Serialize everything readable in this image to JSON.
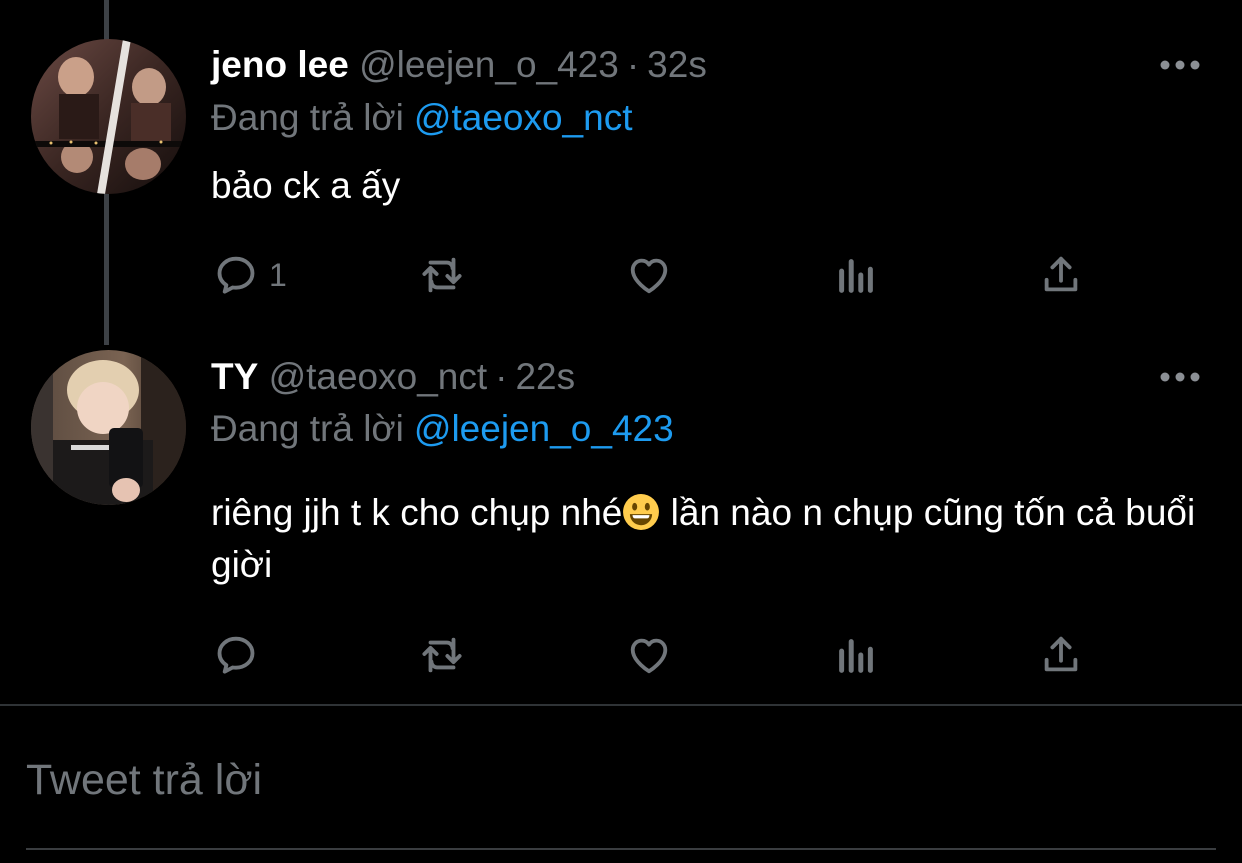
{
  "tweets": [
    {
      "display_name": "jeno lee",
      "handle": "@leejen_o_423",
      "separator": "·",
      "time": "32s",
      "reply_prefix": "Đang trả lời",
      "reply_to": "@taeoxo_nct",
      "text": "bảo ck a ấy",
      "reply_count": "1",
      "avatar_icon": "user-avatar-photo-collage",
      "more_icon": "more-options-icon"
    },
    {
      "display_name": "TY",
      "handle": "@taeoxo_nct",
      "separator": "·",
      "time": "22s",
      "reply_prefix": "Đang trả lời",
      "reply_to": "@leejen_o_423",
      "text_before_emoji": "riêng jjh t k cho chụp nhé",
      "emoji": "grinning-face-emoji",
      "text_after_emoji": " lần nào n chụp cũng tốn cả buổi giời",
      "reply_count": "",
      "avatar_icon": "user-avatar-selfie-photo",
      "more_icon": "more-options-icon"
    }
  ],
  "actions": [
    "reply-icon",
    "retweet-icon",
    "like-icon",
    "analytics-icon",
    "share-icon"
  ],
  "compose": {
    "placeholder": "Tweet trả lời"
  },
  "colors": {
    "background": "#000000",
    "text_primary": "#ffffff",
    "text_secondary": "#71767b",
    "link": "#1d9bf0",
    "divider": "#2f3336"
  }
}
